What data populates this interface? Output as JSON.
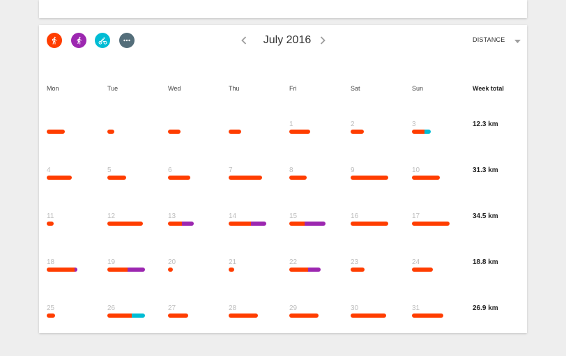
{
  "colors": {
    "walk": "#ff3d00",
    "run": "#9c27b0",
    "cycle": "#00bcd4",
    "more": "#546e7a"
  },
  "header": {
    "activities": [
      {
        "name": "walk-icon",
        "color": "#ff3d00"
      },
      {
        "name": "run-icon",
        "color": "#9c27b0"
      },
      {
        "name": "cycle-icon",
        "color": "#00bcd4"
      },
      {
        "name": "more-icon",
        "color": "#546e7a"
      }
    ],
    "prev_icon": "chevron-left-icon",
    "next_icon": "chevron-right-icon",
    "month": "July 2016",
    "metric": "DISTANCE",
    "metric_icon": "caret-down-icon"
  },
  "calendar": {
    "day_headers": [
      "Mon",
      "Tue",
      "Wed",
      "Thu",
      "Fri",
      "Sat",
      "Sun"
    ],
    "week_total_header": "Week total",
    "weeks": [
      {
        "total": "12.3 km",
        "days": [
          {
            "label": "",
            "segments": [
              [
                "walk",
                0.26
              ]
            ]
          },
          {
            "label": "",
            "segments": [
              [
                "walk",
                0.1
              ]
            ]
          },
          {
            "label": "",
            "segments": [
              [
                "walk",
                0.18
              ]
            ]
          },
          {
            "label": "",
            "segments": [
              [
                "walk",
                0.18
              ]
            ]
          },
          {
            "label": "1",
            "segments": [
              [
                "walk",
                0.3
              ]
            ]
          },
          {
            "label": "2",
            "segments": [
              [
                "walk",
                0.19
              ]
            ]
          },
          {
            "label": "3",
            "segments": [
              [
                "walk",
                0.18
              ],
              [
                "cycle",
                0.09
              ]
            ]
          }
        ]
      },
      {
        "total": "31.3 km",
        "days": [
          {
            "label": "4",
            "segments": [
              [
                "walk",
                0.36
              ]
            ]
          },
          {
            "label": "5",
            "segments": [
              [
                "walk",
                0.27
              ]
            ]
          },
          {
            "label": "6",
            "segments": [
              [
                "walk",
                0.32
              ]
            ]
          },
          {
            "label": "7",
            "segments": [
              [
                "walk",
                0.48
              ]
            ]
          },
          {
            "label": "8",
            "segments": [
              [
                "walk",
                0.25
              ]
            ]
          },
          {
            "label": "9",
            "segments": [
              [
                "walk",
                0.54
              ]
            ]
          },
          {
            "label": "10",
            "segments": [
              [
                "walk",
                0.4
              ]
            ]
          }
        ]
      },
      {
        "total": "34.5 km",
        "days": [
          {
            "label": "11",
            "segments": [
              [
                "walk",
                0.1
              ]
            ]
          },
          {
            "label": "12",
            "segments": [
              [
                "walk",
                0.51
              ]
            ]
          },
          {
            "label": "13",
            "segments": [
              [
                "walk",
                0.2
              ],
              [
                "run",
                0.17
              ]
            ]
          },
          {
            "label": "14",
            "segments": [
              [
                "walk",
                0.32
              ],
              [
                "run",
                0.22
              ]
            ]
          },
          {
            "label": "15",
            "segments": [
              [
                "walk",
                0.22
              ],
              [
                "run",
                0.3
              ]
            ]
          },
          {
            "label": "16",
            "segments": [
              [
                "walk",
                0.54
              ]
            ]
          },
          {
            "label": "17",
            "segments": [
              [
                "walk",
                0.54
              ]
            ]
          }
        ]
      },
      {
        "total": "18.8 km",
        "days": [
          {
            "label": "18",
            "segments": [
              [
                "walk",
                0.4
              ],
              [
                "run",
                0.04
              ]
            ]
          },
          {
            "label": "19",
            "segments": [
              [
                "walk",
                0.29
              ],
              [
                "run",
                0.25
              ]
            ]
          },
          {
            "label": "20",
            "segments": [
              [
                "walk",
                0.07
              ]
            ]
          },
          {
            "label": "21",
            "segments": [
              [
                "walk",
                0.08
              ]
            ]
          },
          {
            "label": "22",
            "segments": [
              [
                "walk",
                0.27
              ],
              [
                "run",
                0.18
              ]
            ]
          },
          {
            "label": "23",
            "segments": [
              [
                "walk",
                0.2
              ]
            ]
          },
          {
            "label": "24",
            "segments": [
              [
                "walk",
                0.3
              ]
            ]
          }
        ]
      },
      {
        "total": "26.9 km",
        "days": [
          {
            "label": "25",
            "segments": [
              [
                "walk",
                0.12
              ]
            ]
          },
          {
            "label": "26",
            "segments": [
              [
                "walk",
                0.35
              ],
              [
                "cycle",
                0.19
              ]
            ]
          },
          {
            "label": "27",
            "segments": [
              [
                "walk",
                0.29
              ]
            ]
          },
          {
            "label": "28",
            "segments": [
              [
                "walk",
                0.42
              ]
            ]
          },
          {
            "label": "29",
            "segments": [
              [
                "walk",
                0.42
              ]
            ]
          },
          {
            "label": "30",
            "segments": [
              [
                "walk",
                0.51
              ]
            ]
          },
          {
            "label": "31",
            "segments": [
              [
                "walk",
                0.45
              ]
            ]
          }
        ]
      }
    ]
  }
}
